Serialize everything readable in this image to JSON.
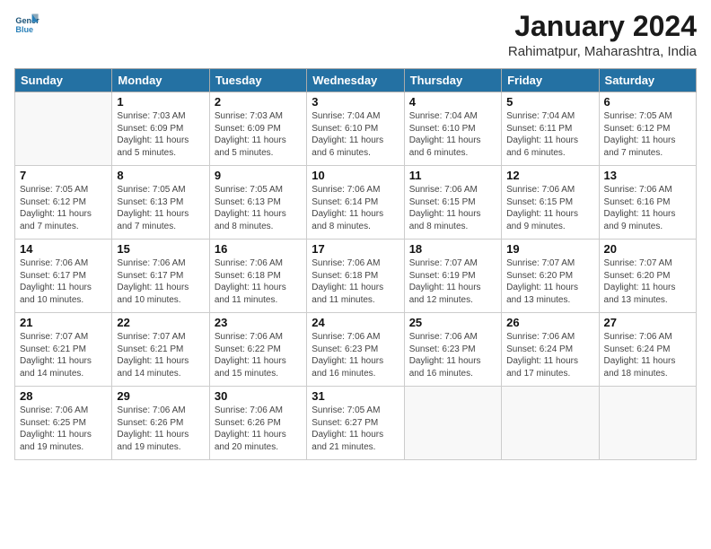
{
  "header": {
    "logo_general": "General",
    "logo_blue": "Blue",
    "month_title": "January 2024",
    "subtitle": "Rahimatpur, Maharashtra, India"
  },
  "days_of_week": [
    "Sunday",
    "Monday",
    "Tuesday",
    "Wednesday",
    "Thursday",
    "Friday",
    "Saturday"
  ],
  "weeks": [
    [
      {
        "day": "",
        "sunrise": "",
        "sunset": "",
        "daylight": ""
      },
      {
        "day": "1",
        "sunrise": "Sunrise: 7:03 AM",
        "sunset": "Sunset: 6:09 PM",
        "daylight": "Daylight: 11 hours and 5 minutes."
      },
      {
        "day": "2",
        "sunrise": "Sunrise: 7:03 AM",
        "sunset": "Sunset: 6:09 PM",
        "daylight": "Daylight: 11 hours and 5 minutes."
      },
      {
        "day": "3",
        "sunrise": "Sunrise: 7:04 AM",
        "sunset": "Sunset: 6:10 PM",
        "daylight": "Daylight: 11 hours and 6 minutes."
      },
      {
        "day": "4",
        "sunrise": "Sunrise: 7:04 AM",
        "sunset": "Sunset: 6:10 PM",
        "daylight": "Daylight: 11 hours and 6 minutes."
      },
      {
        "day": "5",
        "sunrise": "Sunrise: 7:04 AM",
        "sunset": "Sunset: 6:11 PM",
        "daylight": "Daylight: 11 hours and 6 minutes."
      },
      {
        "day": "6",
        "sunrise": "Sunrise: 7:05 AM",
        "sunset": "Sunset: 6:12 PM",
        "daylight": "Daylight: 11 hours and 7 minutes."
      }
    ],
    [
      {
        "day": "7",
        "sunrise": "Sunrise: 7:05 AM",
        "sunset": "Sunset: 6:12 PM",
        "daylight": "Daylight: 11 hours and 7 minutes."
      },
      {
        "day": "8",
        "sunrise": "Sunrise: 7:05 AM",
        "sunset": "Sunset: 6:13 PM",
        "daylight": "Daylight: 11 hours and 7 minutes."
      },
      {
        "day": "9",
        "sunrise": "Sunrise: 7:05 AM",
        "sunset": "Sunset: 6:13 PM",
        "daylight": "Daylight: 11 hours and 8 minutes."
      },
      {
        "day": "10",
        "sunrise": "Sunrise: 7:06 AM",
        "sunset": "Sunset: 6:14 PM",
        "daylight": "Daylight: 11 hours and 8 minutes."
      },
      {
        "day": "11",
        "sunrise": "Sunrise: 7:06 AM",
        "sunset": "Sunset: 6:15 PM",
        "daylight": "Daylight: 11 hours and 8 minutes."
      },
      {
        "day": "12",
        "sunrise": "Sunrise: 7:06 AM",
        "sunset": "Sunset: 6:15 PM",
        "daylight": "Daylight: 11 hours and 9 minutes."
      },
      {
        "day": "13",
        "sunrise": "Sunrise: 7:06 AM",
        "sunset": "Sunset: 6:16 PM",
        "daylight": "Daylight: 11 hours and 9 minutes."
      }
    ],
    [
      {
        "day": "14",
        "sunrise": "Sunrise: 7:06 AM",
        "sunset": "Sunset: 6:17 PM",
        "daylight": "Daylight: 11 hours and 10 minutes."
      },
      {
        "day": "15",
        "sunrise": "Sunrise: 7:06 AM",
        "sunset": "Sunset: 6:17 PM",
        "daylight": "Daylight: 11 hours and 10 minutes."
      },
      {
        "day": "16",
        "sunrise": "Sunrise: 7:06 AM",
        "sunset": "Sunset: 6:18 PM",
        "daylight": "Daylight: 11 hours and 11 minutes."
      },
      {
        "day": "17",
        "sunrise": "Sunrise: 7:06 AM",
        "sunset": "Sunset: 6:18 PM",
        "daylight": "Daylight: 11 hours and 11 minutes."
      },
      {
        "day": "18",
        "sunrise": "Sunrise: 7:07 AM",
        "sunset": "Sunset: 6:19 PM",
        "daylight": "Daylight: 11 hours and 12 minutes."
      },
      {
        "day": "19",
        "sunrise": "Sunrise: 7:07 AM",
        "sunset": "Sunset: 6:20 PM",
        "daylight": "Daylight: 11 hours and 13 minutes."
      },
      {
        "day": "20",
        "sunrise": "Sunrise: 7:07 AM",
        "sunset": "Sunset: 6:20 PM",
        "daylight": "Daylight: 11 hours and 13 minutes."
      }
    ],
    [
      {
        "day": "21",
        "sunrise": "Sunrise: 7:07 AM",
        "sunset": "Sunset: 6:21 PM",
        "daylight": "Daylight: 11 hours and 14 minutes."
      },
      {
        "day": "22",
        "sunrise": "Sunrise: 7:07 AM",
        "sunset": "Sunset: 6:21 PM",
        "daylight": "Daylight: 11 hours and 14 minutes."
      },
      {
        "day": "23",
        "sunrise": "Sunrise: 7:06 AM",
        "sunset": "Sunset: 6:22 PM",
        "daylight": "Daylight: 11 hours and 15 minutes."
      },
      {
        "day": "24",
        "sunrise": "Sunrise: 7:06 AM",
        "sunset": "Sunset: 6:23 PM",
        "daylight": "Daylight: 11 hours and 16 minutes."
      },
      {
        "day": "25",
        "sunrise": "Sunrise: 7:06 AM",
        "sunset": "Sunset: 6:23 PM",
        "daylight": "Daylight: 11 hours and 16 minutes."
      },
      {
        "day": "26",
        "sunrise": "Sunrise: 7:06 AM",
        "sunset": "Sunset: 6:24 PM",
        "daylight": "Daylight: 11 hours and 17 minutes."
      },
      {
        "day": "27",
        "sunrise": "Sunrise: 7:06 AM",
        "sunset": "Sunset: 6:24 PM",
        "daylight": "Daylight: 11 hours and 18 minutes."
      }
    ],
    [
      {
        "day": "28",
        "sunrise": "Sunrise: 7:06 AM",
        "sunset": "Sunset: 6:25 PM",
        "daylight": "Daylight: 11 hours and 19 minutes."
      },
      {
        "day": "29",
        "sunrise": "Sunrise: 7:06 AM",
        "sunset": "Sunset: 6:26 PM",
        "daylight": "Daylight: 11 hours and 19 minutes."
      },
      {
        "day": "30",
        "sunrise": "Sunrise: 7:06 AM",
        "sunset": "Sunset: 6:26 PM",
        "daylight": "Daylight: 11 hours and 20 minutes."
      },
      {
        "day": "31",
        "sunrise": "Sunrise: 7:05 AM",
        "sunset": "Sunset: 6:27 PM",
        "daylight": "Daylight: 11 hours and 21 minutes."
      },
      {
        "day": "",
        "sunrise": "",
        "sunset": "",
        "daylight": ""
      },
      {
        "day": "",
        "sunrise": "",
        "sunset": "",
        "daylight": ""
      },
      {
        "day": "",
        "sunrise": "",
        "sunset": "",
        "daylight": ""
      }
    ]
  ]
}
